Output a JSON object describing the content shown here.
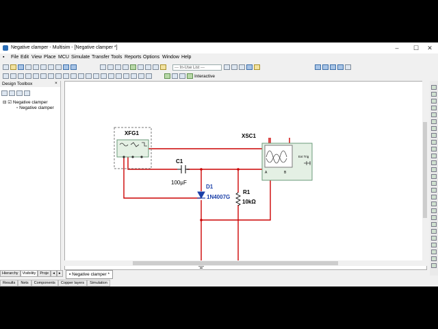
{
  "window": {
    "title": "Negative clamper - Multisim - [Negative clamper *]"
  },
  "menu": [
    "File",
    "Edit",
    "View",
    "Place",
    "MCU",
    "Simulate",
    "Transfer",
    "Tools",
    "Reports",
    "Options",
    "Window",
    "Help"
  ],
  "toolbar": {
    "in_use_list": "--- In-Use List ---",
    "interactive": "Interactive"
  },
  "design_toolbox": {
    "header": "Design Toolbox",
    "root": "Negative clamper",
    "child": "Negative clamper",
    "tabs": [
      "Hierarchy",
      "Visibility",
      "Proje"
    ]
  },
  "schematic": {
    "function_generator": {
      "ref": "XFG1"
    },
    "oscilloscope": {
      "ref": "XSC1",
      "ext_trig_label": "Ext Trig",
      "channel_a": "A",
      "channel_b": "B"
    },
    "capacitor": {
      "ref": "C1",
      "value": "100µF"
    },
    "diode": {
      "ref": "D1",
      "part": "1N4007G"
    },
    "resistor": {
      "ref": "R1",
      "value": "10kΩ"
    },
    "colors": {
      "wire": "#cc0000",
      "diode_text": "#1a3fa8",
      "instrument": "#6a9a7a"
    }
  },
  "document_tab": "Negative clamper *",
  "bottom_tabs": [
    "Results",
    "Nets",
    "Components",
    "Copper layers",
    "Simulation"
  ]
}
